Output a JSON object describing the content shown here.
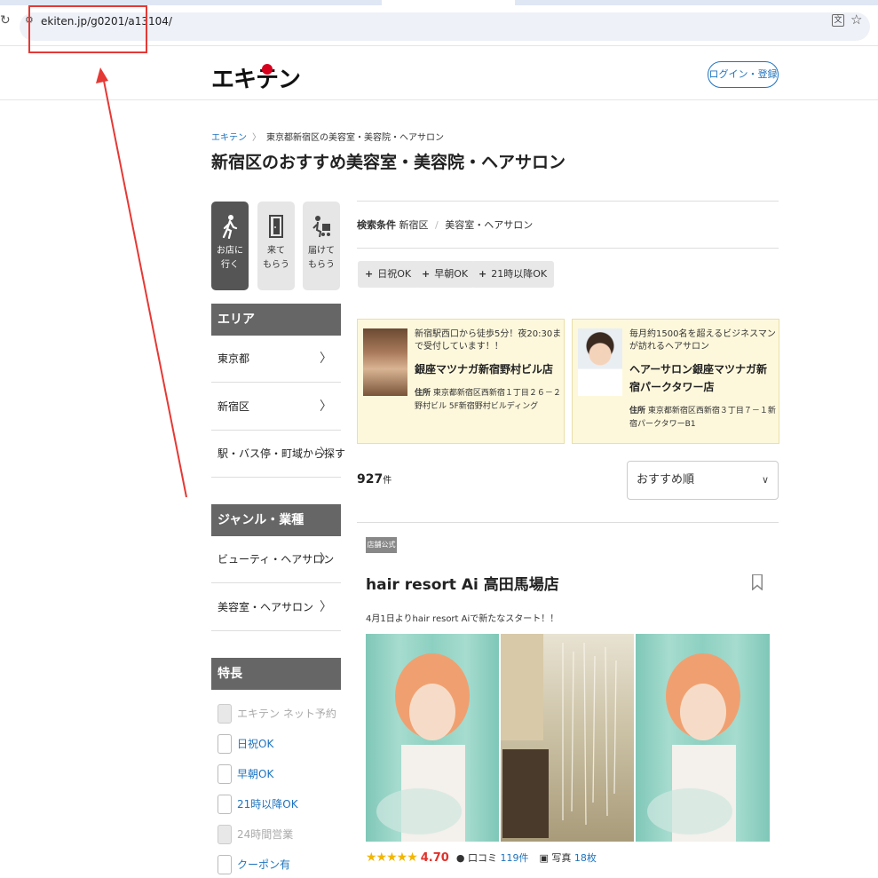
{
  "browser": {
    "url": "ekiten.jp/g0201/a13104/",
    "reload_icon": "reload-icon",
    "star_icon": "bookmark-star-icon",
    "translate_icon": "translate-icon"
  },
  "header": {
    "logo": "エキテン",
    "login": "ログイン・登録"
  },
  "breadcrumb": {
    "home": "エキテン",
    "current": "東京都新宿区の美容室・美容院・ヘアサロン"
  },
  "page_title": "新宿区のおすすめ美容室・美容院・ヘアサロン",
  "modes": [
    {
      "line1": "お店に",
      "line2": "行く"
    },
    {
      "line1": "来て",
      "line2": "もらう"
    },
    {
      "line1": "届けて",
      "line2": "もらう"
    }
  ],
  "sidebar": {
    "area_heading": "エリア",
    "area_items": [
      "東京都",
      "新宿区",
      "駅・バス停・町域から探す"
    ],
    "genre_heading": "ジャンル・業種",
    "genre_items": [
      "ビューティ・ヘアサロン",
      "美容室・ヘアサロン"
    ],
    "feature_heading": "特長",
    "features": [
      {
        "label": "エキテン ネット予約",
        "disabled": true
      },
      {
        "label": "日祝OK",
        "disabled": false
      },
      {
        "label": "早朝OK",
        "disabled": false
      },
      {
        "label": "21時以降OK",
        "disabled": false
      },
      {
        "label": "24時間営業",
        "disabled": true
      },
      {
        "label": "クーポン有",
        "disabled": false
      }
    ],
    "chevron": "〉"
  },
  "conditions": {
    "label": "検索条件",
    "area": "新宿区",
    "genre": "美容室・ヘアサロン"
  },
  "chips": [
    "日祝OK",
    "早朝OK",
    "21時以降OK"
  ],
  "ads": [
    {
      "lead": "新宿駅西口から徒歩5分！夜20:30まで受付しています！！",
      "name": "銀座マツナガ新宿野村ビル店",
      "addr_label": "住所",
      "addr": "東京都新宿区西新宿１丁目２６－２ 野村ビル 5F新宿野村ビルディング"
    },
    {
      "lead": "毎月約1500名を超えるビジネスマンが訪れるヘアサロン",
      "name": "ヘアーサロン銀座マツナガ新宿パークタワー店",
      "addr_label": "住所",
      "addr": "東京都新宿区西新宿３丁目７－１新宿パークタワーB1"
    }
  ],
  "result": {
    "count": "927",
    "unit": "件",
    "sort": "おすすめ順"
  },
  "shop": {
    "badge": "店舗公式",
    "name": "hair resort Ai 高田馬場店",
    "catch": "4月1日よりhair resort Aiで新たなスタート！！",
    "stars": "★★★★★",
    "rating": 4.7,
    "rating_text": "4.70",
    "reviews_label": "口コミ",
    "reviews": "119件",
    "photos_label": "写真",
    "photos": "18枚"
  }
}
